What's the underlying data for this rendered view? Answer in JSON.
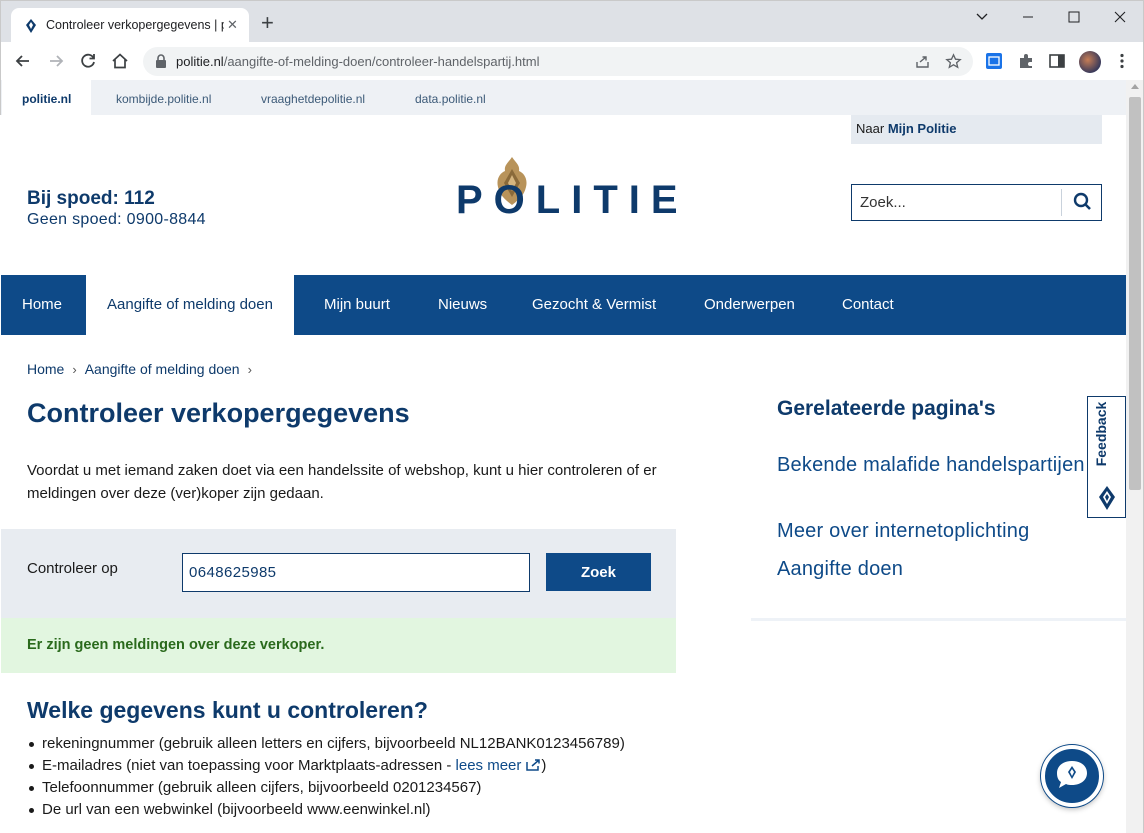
{
  "browser": {
    "tab_title": "Controleer verkopergegevens | p",
    "tab_close": "✕",
    "new_tab": "+",
    "url_domain": "politie.nl",
    "url_path": "/aangifte-of-melding-doen/controleer-handelspartij.html"
  },
  "bookmarks": [
    {
      "label": "politie.nl"
    },
    {
      "label": "kombijde.politie.nl"
    },
    {
      "label": "vraaghetdepolitie.nl"
    },
    {
      "label": "data.politie.nl"
    }
  ],
  "header": {
    "mijn_politie_prefix": "Naar",
    "mijn_politie_bold": "Mijn Politie",
    "spoed_line1": "Bij spoed: 112",
    "spoed_line2": "Geen spoed: 0900-8844",
    "logo_text": "POLITIE",
    "search_placeholder": "Zoek..."
  },
  "nav": [
    {
      "label": "Home"
    },
    {
      "label": "Aangifte of melding doen"
    },
    {
      "label": "Mijn buurt"
    },
    {
      "label": "Nieuws"
    },
    {
      "label": "Gezocht & Vermist"
    },
    {
      "label": "Onderwerpen"
    },
    {
      "label": "Contact"
    }
  ],
  "breadcrumb": {
    "home": "Home",
    "sep": "›",
    "current": "Aangifte of melding doen"
  },
  "main": {
    "title": "Controleer verkopergegevens",
    "intro": "Voordat u met iemand zaken doet via een handelssite of webshop, kunt u hier controleren of er meldingen over deze (ver)koper zijn gedaan.",
    "check_label": "Controleer op",
    "check_value": "0648625985",
    "check_button": "Zoek",
    "result": "Er zijn geen meldingen over deze verkoper.",
    "h2": "Welke gegevens kunt u controleren?",
    "list": [
      "rekeningnummer (gebruik alleen letters en cijfers, bijvoorbeeld NL12BANK0123456789)",
      "E-mailadres (niet van toepassing voor Marktplaats-adressen - ",
      "Telefoonnummer (gebruik alleen cijfers, bijvoorbeeld 0201234567)",
      "De url van een webwinkel (bijvoorbeeld www.eenwinkel.nl)"
    ],
    "list_link": "lees meer",
    "list_close": ")"
  },
  "sidebar": {
    "title": "Gerelateerde pagina's",
    "links": [
      "Bekende malafide handelspartijen",
      "Meer over internetoplichting",
      "Aangifte doen"
    ]
  },
  "feedback_label": "Feedback",
  "colors": {
    "brand_blue": "#0e4a88",
    "brand_dark": "#0e3a6b",
    "badge_gold": "#b8935a",
    "success_bg": "#e2f6e0",
    "success_text": "#2a6a1c"
  }
}
